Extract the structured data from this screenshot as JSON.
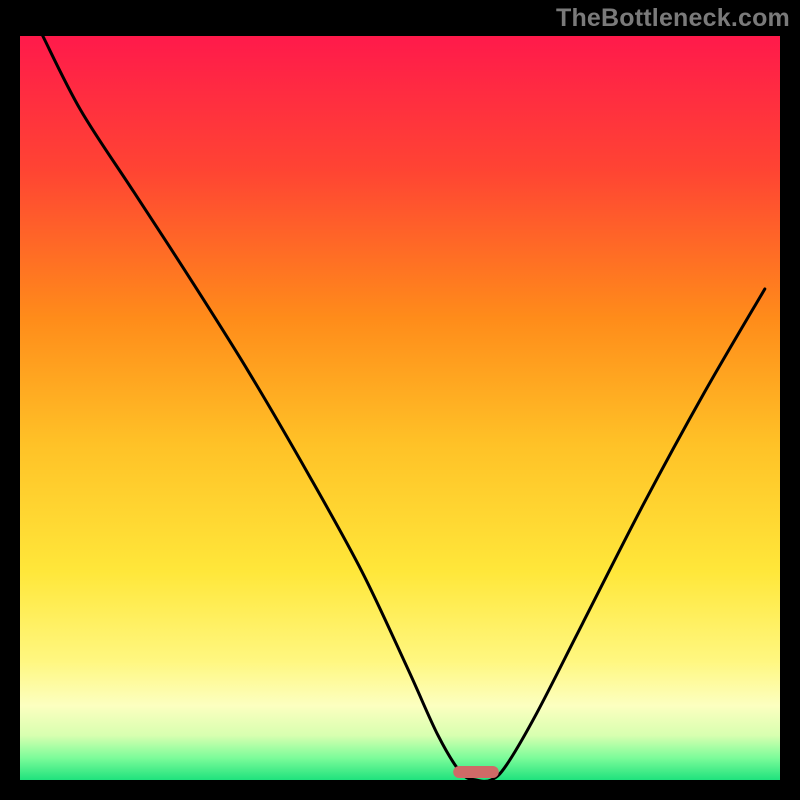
{
  "watermark": {
    "text": "TheBottleneck.com"
  },
  "colors": {
    "frame": "#000000",
    "watermark": "#7a7a7a",
    "curve": "#000000",
    "marker_fill": "#cf6a67",
    "gradient_stops": [
      {
        "offset": 0.0,
        "color": "#ff1a4b"
      },
      {
        "offset": 0.18,
        "color": "#ff4433"
      },
      {
        "offset": 0.38,
        "color": "#ff8c1a"
      },
      {
        "offset": 0.55,
        "color": "#ffc227"
      },
      {
        "offset": 0.72,
        "color": "#ffe73a"
      },
      {
        "offset": 0.84,
        "color": "#fff780"
      },
      {
        "offset": 0.9,
        "color": "#fcffc0"
      },
      {
        "offset": 0.94,
        "color": "#d8ffb0"
      },
      {
        "offset": 0.97,
        "color": "#7dfc9a"
      },
      {
        "offset": 1.0,
        "color": "#1fe27d"
      }
    ]
  },
  "chart_data": {
    "type": "line",
    "title": "",
    "xlabel": "",
    "ylabel": "",
    "xlim": [
      0,
      100
    ],
    "ylim": [
      0,
      100
    ],
    "grid": false,
    "legend": false,
    "series": [
      {
        "name": "bottleneck-curve",
        "x": [
          3,
          8,
          15,
          22,
          30,
          38,
          45,
          51,
          55,
          58,
          60,
          62,
          64,
          68,
          74,
          82,
          90,
          98
        ],
        "y": [
          100,
          90,
          79,
          68,
          55,
          41,
          28,
          15,
          6,
          1,
          0,
          0,
          2,
          9,
          21,
          37,
          52,
          66
        ]
      }
    ],
    "marker": {
      "x_center": 60,
      "y": 0,
      "width": 6,
      "height": 2
    }
  }
}
